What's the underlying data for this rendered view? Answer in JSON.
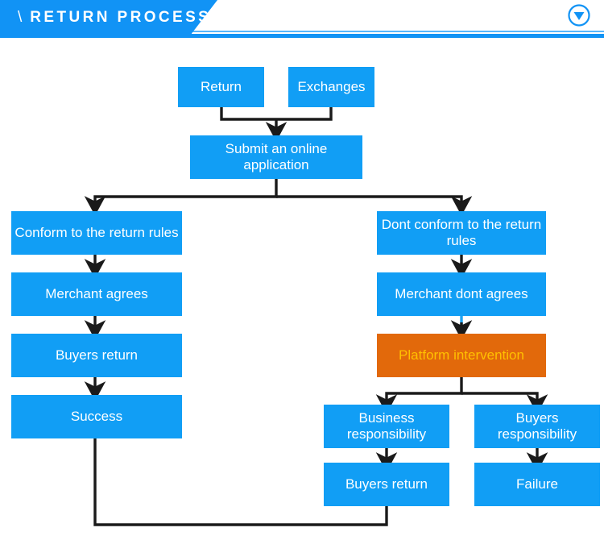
{
  "header": {
    "slash": "\\",
    "title": "RETURN PROCESS",
    "collapse_icon": "circle-triangle-down-icon",
    "accent_color": "#1193f5"
  },
  "flow": {
    "title": "Return Process",
    "node_color": "#119ef5",
    "node_text_color": "#ffffff",
    "accent_node_color": "#e2690b",
    "accent_node_text_color": "#ffc000",
    "connector_color": "#1a1a1a",
    "nodes": [
      {
        "id": "return",
        "label": "Return"
      },
      {
        "id": "exchanges",
        "label": "Exchanges"
      },
      {
        "id": "submit",
        "label": "Submit an online application"
      },
      {
        "id": "conform",
        "label": "Conform to the return rules"
      },
      {
        "id": "merchant_agrees",
        "label": "Merchant agrees"
      },
      {
        "id": "buyers_return_left",
        "label": "Buyers return"
      },
      {
        "id": "success",
        "label": "Success"
      },
      {
        "id": "dont_conform",
        "label": "Dont conform to the return rules"
      },
      {
        "id": "merchant_dont",
        "label": "Merchant dont agrees"
      },
      {
        "id": "platform",
        "label": "Platform intervention"
      },
      {
        "id": "business_resp",
        "label": "Business responsibility"
      },
      {
        "id": "buyers_resp",
        "label": "Buyers responsibility"
      },
      {
        "id": "buyers_return_right",
        "label": "Buyers return"
      },
      {
        "id": "failure",
        "label": "Failure"
      }
    ]
  }
}
